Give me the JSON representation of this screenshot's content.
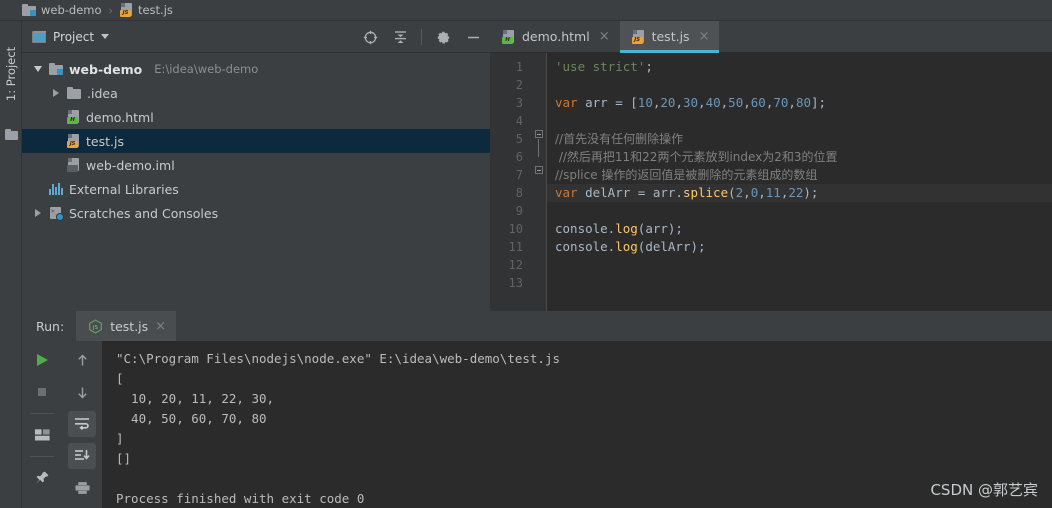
{
  "breadcrumb": {
    "project_name": "web-demo",
    "separator": "›",
    "file_name": "test.js"
  },
  "rail": {
    "project_tab_label": "1: Project",
    "folder_icon": "folder-icon"
  },
  "project_panel": {
    "title": "Project",
    "caret_icon": "chevron-down-icon",
    "actions": [
      {
        "name": "select-opened-file-icon",
        "label": "Select Opened File"
      },
      {
        "name": "collapse-all-icon",
        "label": "Collapse All"
      },
      {
        "name": "gear-icon",
        "label": "Settings"
      },
      {
        "name": "minimize-icon",
        "label": "Hide"
      }
    ],
    "tree": [
      {
        "label": "web-demo",
        "path": "E:\\idea\\web-demo",
        "icon": "module-icon",
        "arrow": "expanded",
        "indent": 0,
        "bold": true,
        "selected": false
      },
      {
        "label": ".idea",
        "path": "",
        "icon": "folder-icon",
        "arrow": "collapsed",
        "indent": 1,
        "bold": false,
        "selected": false
      },
      {
        "label": "demo.html",
        "path": "",
        "icon": "html-file-icon",
        "arrow": "none",
        "indent": 1,
        "bold": false,
        "selected": false
      },
      {
        "label": "test.js",
        "path": "",
        "icon": "js-file-icon",
        "arrow": "none",
        "indent": 1,
        "bold": false,
        "selected": true
      },
      {
        "label": "web-demo.iml",
        "path": "",
        "icon": "iml-file-icon",
        "arrow": "none",
        "indent": 1,
        "bold": false,
        "selected": false
      },
      {
        "label": "External Libraries",
        "path": "",
        "icon": "libraries-icon",
        "arrow": "none",
        "indent": 0,
        "bold": false,
        "selected": false
      },
      {
        "label": "Scratches and Consoles",
        "path": "",
        "icon": "scratches-icon",
        "arrow": "collapsed",
        "indent": 0,
        "bold": false,
        "selected": false
      }
    ]
  },
  "editor": {
    "tabs": [
      {
        "label": "demo.html",
        "icon": "html-file-icon",
        "active": false,
        "close_icon": "×"
      },
      {
        "label": "test.js",
        "icon": "js-file-icon",
        "active": true,
        "close_icon": "×"
      }
    ],
    "current_line": 8,
    "line_numbers": [
      "1",
      "2",
      "3",
      "4",
      "5",
      "6",
      "7",
      "8",
      "9",
      "10",
      "11",
      "12",
      "13"
    ],
    "lines": [
      {
        "n": 1,
        "tokens": [
          {
            "t": "'use strict'",
            "c": "str"
          },
          {
            "t": ";",
            "c": "id"
          }
        ]
      },
      {
        "n": 2,
        "tokens": []
      },
      {
        "n": 3,
        "tokens": [
          {
            "t": "var",
            "c": "kw"
          },
          {
            "t": " arr = [",
            "c": "id"
          },
          {
            "t": "10",
            "c": "num"
          },
          {
            "t": ",",
            "c": "id"
          },
          {
            "t": "20",
            "c": "num"
          },
          {
            "t": ",",
            "c": "id"
          },
          {
            "t": "30",
            "c": "num"
          },
          {
            "t": ",",
            "c": "id"
          },
          {
            "t": "40",
            "c": "num"
          },
          {
            "t": ",",
            "c": "id"
          },
          {
            "t": "50",
            "c": "num"
          },
          {
            "t": ",",
            "c": "id"
          },
          {
            "t": "60",
            "c": "num"
          },
          {
            "t": ",",
            "c": "id"
          },
          {
            "t": "70",
            "c": "num"
          },
          {
            "t": ",",
            "c": "id"
          },
          {
            "t": "80",
            "c": "num"
          },
          {
            "t": "];",
            "c": "id"
          }
        ]
      },
      {
        "n": 4,
        "tokens": []
      },
      {
        "n": 5,
        "tokens": [
          {
            "t": "//首先没有任何删除操作",
            "c": "cmt"
          }
        ]
      },
      {
        "n": 6,
        "tokens": [
          {
            "t": " //然后再把11和22两个元素放到index为2和3的位置",
            "c": "cmt"
          }
        ]
      },
      {
        "n": 7,
        "tokens": [
          {
            "t": "//splice 操作的返回值是被删除的元素组成的数组",
            "c": "cmt"
          }
        ]
      },
      {
        "n": 8,
        "tokens": [
          {
            "t": "var",
            "c": "kw"
          },
          {
            "t": " delArr = arr.",
            "c": "id"
          },
          {
            "t": "splice",
            "c": "fn"
          },
          {
            "t": "(",
            "c": "id"
          },
          {
            "t": "2",
            "c": "num"
          },
          {
            "t": ",",
            "c": "id"
          },
          {
            "t": "0",
            "c": "num"
          },
          {
            "t": ",",
            "c": "id"
          },
          {
            "t": "11",
            "c": "num"
          },
          {
            "t": ",",
            "c": "id"
          },
          {
            "t": "22",
            "c": "num"
          },
          {
            "t": ");",
            "c": "id"
          }
        ]
      },
      {
        "n": 9,
        "tokens": []
      },
      {
        "n": 10,
        "tokens": [
          {
            "t": "console.",
            "c": "id"
          },
          {
            "t": "log",
            "c": "fn"
          },
          {
            "t": "(arr);",
            "c": "id"
          }
        ]
      },
      {
        "n": 11,
        "tokens": [
          {
            "t": "console.",
            "c": "id"
          },
          {
            "t": "log",
            "c": "fn"
          },
          {
            "t": "(delArr);",
            "c": "id"
          }
        ]
      },
      {
        "n": 12,
        "tokens": []
      },
      {
        "n": 13,
        "tokens": []
      }
    ]
  },
  "run_panel": {
    "label": "Run:",
    "tab_label": "test.js",
    "tab_icon": "nodejs-icon",
    "tab_close_icon": "×",
    "tools_left": [
      {
        "name": "run-button",
        "icon": "play-icon"
      },
      {
        "name": "stop-button",
        "icon": "stop-icon"
      },
      {
        "name": "layout-button",
        "icon": "layout-icon"
      },
      {
        "name": "pin-button",
        "icon": "pin-icon"
      }
    ],
    "tools_right": [
      {
        "name": "up-button",
        "icon": "arrow-up-icon"
      },
      {
        "name": "down-button",
        "icon": "arrow-down-icon"
      },
      {
        "name": "soft-wrap-button",
        "icon": "soft-wrap-icon"
      },
      {
        "name": "scroll-to-end-button",
        "icon": "scroll-to-end-icon"
      },
      {
        "name": "print-button",
        "icon": "printer-icon"
      }
    ],
    "console_lines": [
      "\"C:\\Program Files\\nodejs\\node.exe\" E:\\idea\\web-demo\\test.js",
      "[",
      "  10, 20, 11, 22, 30,",
      "  40, 50, 60, 70, 80",
      "]",
      "[]",
      "",
      "Process finished with exit code 0"
    ]
  },
  "watermark": "CSDN @郭艺宾",
  "colors": {
    "panel_bg": "#3c3f41",
    "editor_bg": "#2b2b2b",
    "gutter_bg": "#313335",
    "selection_bg": "#0d293e",
    "accent": "#4ab3d8",
    "keyword": "#cc7832",
    "number": "#6897bb",
    "string": "#6a8759",
    "comment": "#808080",
    "function": "#ffc66d",
    "text": "#a9b7c6"
  }
}
